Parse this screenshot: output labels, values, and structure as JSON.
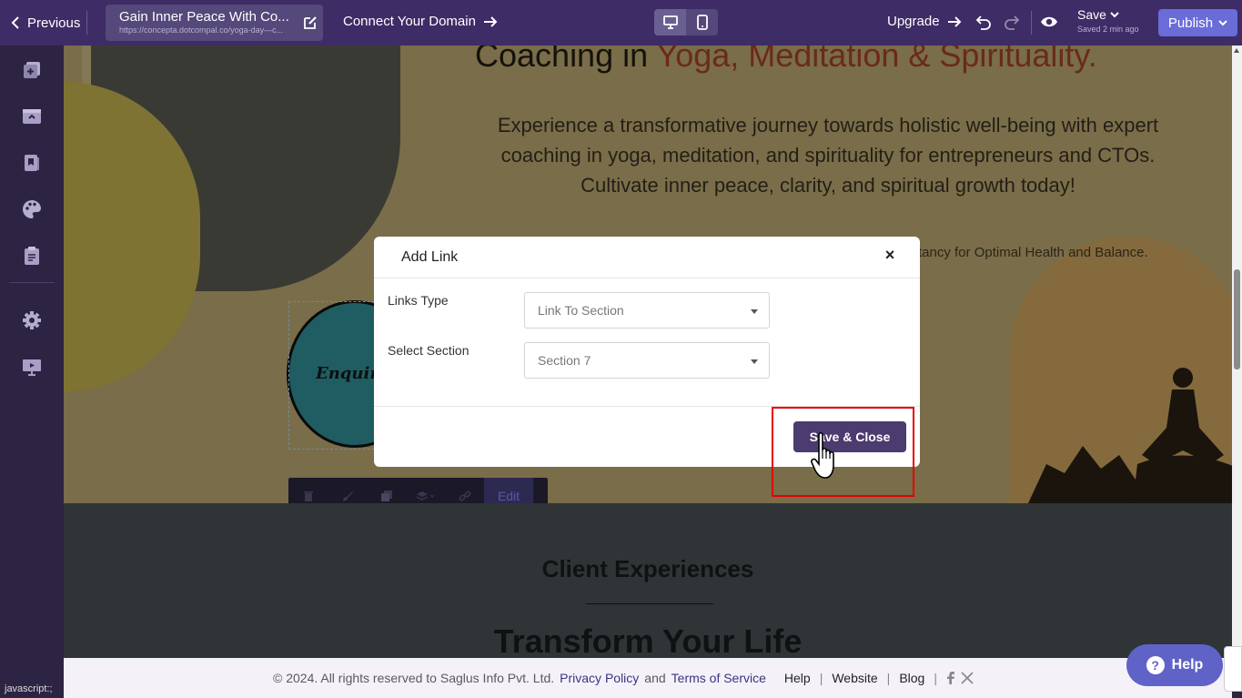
{
  "topbar": {
    "previous_label": "Previous",
    "page_title": "Gain Inner Peace With Co...",
    "page_url": "https://concepta.dotcompal.co/yoga-day—c...",
    "connect_domain_label": "Connect Your Domain",
    "upgrade_label": "Upgrade",
    "save_label": "Save",
    "save_status": "Saved 2 min ago",
    "publish_label": "Publish"
  },
  "canvas": {
    "heading_prefix": "Coaching in ",
    "heading_accent": "Yoga, Meditation & Spirituality.",
    "paragraph": "Experience a transformative journey towards holistic well-being with expert coaching in yoga, meditation, and spirituality for entrepreneurs and CTOs. Cultivate inner peace, clarity, and spiritual growth today!",
    "subtext": "tancy for Optimal Health and Balance.",
    "enquiry_text": "Enquir",
    "edit_label": "Edit",
    "client_heading": "Client Experiences",
    "transform_heading": "Transform Your Life"
  },
  "modal": {
    "title": "Add Link",
    "links_type_label": "Links Type",
    "links_type_value": "Link To Section",
    "section_label": "Select Section",
    "section_value": "Section 7",
    "save_close_label": "Save & Close"
  },
  "footer": {
    "copyright": "©  2024. All rights reserved to Saglus Info Pvt. Ltd.",
    "privacy": "Privacy Policy",
    "and": "and",
    "terms": "Terms of Service",
    "help": "Help",
    "website": "Website",
    "blog": "Blog",
    "sep": "|"
  },
  "help_button": {
    "label": "Help",
    "glyph": "?"
  },
  "status_bar": "javascript:;",
  "colors": {
    "topbar": "#3d2c66",
    "publish": "#6a6cd8",
    "primary_button": "#4b3b6e",
    "highlight": "#e60000"
  }
}
